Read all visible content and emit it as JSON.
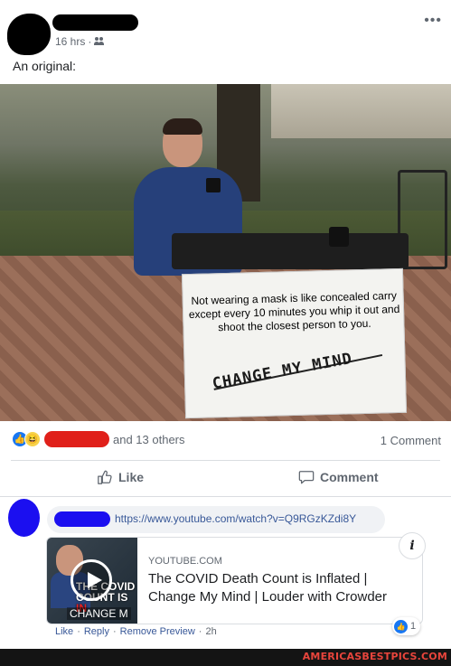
{
  "post": {
    "timestamp": "16 hrs",
    "audience_icon": "friends-icon",
    "text": "An original:",
    "more_icon": "•••"
  },
  "meme": {
    "sign_text": "Not wearing a mask is like concealed carry except every 10 minutes you whip it out and shoot the closest person to you.",
    "sign_caption": "CHANGE MY MIND"
  },
  "reactions": {
    "icons": [
      "like-icon",
      "haha-icon"
    ],
    "others_text": "and 13 others",
    "comments_count": "1 Comment"
  },
  "actions": {
    "like_label": "Like",
    "comment_label": "Comment"
  },
  "comment": {
    "link": "https://www.youtube.com/watch?v=Q9RGzKZdi8Y",
    "preview": {
      "domain": "YOUTUBE.COM",
      "title": "The COVID Death Count is Inflated | Change My Mind | Louder with Crowder",
      "thumb_text_line1": "THE COVID",
      "thumb_text_line2a": "COUNT IS ",
      "thumb_text_line2b": "IN",
      "thumb_caption": "CHANGE M"
    },
    "like_label": "Like",
    "reply_label": "Reply",
    "remove_preview_label": "Remove Preview",
    "age": "2h",
    "reaction_count": "1"
  },
  "watermark": "AMERICASBESTPICS.COM",
  "colors": {
    "link": "#385898",
    "facebook_blue": "#1877f2",
    "redaction_black": "#000000",
    "redaction_red": "#e0201a",
    "redaction_blue": "#1b0ff0",
    "watermark": "#e8453c"
  }
}
